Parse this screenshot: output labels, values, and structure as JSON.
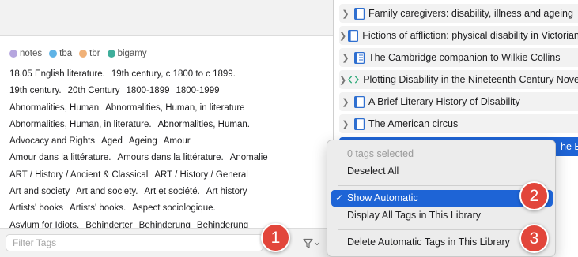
{
  "colored_tags": [
    {
      "label": "notes",
      "color": "#b6a6df"
    },
    {
      "label": "tba",
      "color": "#5fb3e6"
    },
    {
      "label": "tbr",
      "color": "#f0b177"
    },
    {
      "label": "bigamy",
      "color": "#3fae9b"
    }
  ],
  "tag_rows": [
    [
      "18.05 English literature.",
      "19th century, c 1800 to c 1899."
    ],
    [
      "19th century.",
      "20th Century",
      "1800-1899",
      "1800-1999"
    ],
    [
      "Abnormalities, Human",
      "Abnormalities, Human, in literature"
    ],
    [
      "Abnormalities, Human, in literature.",
      "Abnormalities, Human."
    ],
    [
      "Advocacy and Rights",
      "Aged",
      "Ageing",
      "Amour"
    ],
    [
      "Amour dans la littérature.",
      "Amours dans la littérature.",
      "Anomalie"
    ],
    [
      "ART / History / Ancient & Classical",
      "ART / History / General"
    ],
    [
      "Art and society",
      "Art and society.",
      "Art et société.",
      "Art history"
    ],
    [
      "Artists' books",
      "Artists' books.",
      "Aspect sociologique."
    ],
    [
      "Asylum for Idiots.",
      "Behinderter",
      "Behinderung",
      "Behinderung"
    ]
  ],
  "filter": {
    "placeholder": "Filter Tags",
    "button_icon": "filter-icon"
  },
  "items": [
    {
      "title": "Family caregivers: disability, illness and ageing",
      "icon": "book-icon"
    },
    {
      "title": "Fictions of affliction: physical disability in Victorian culture",
      "icon": "book-icon"
    },
    {
      "title": "The Cambridge companion to Wilkie Collins",
      "icon": "book-section-icon"
    },
    {
      "title": "Plotting Disability in the Nineteenth-Century Novel",
      "icon": "webpage-icon"
    },
    {
      "title": "A Brief Literary History of Disability",
      "icon": "book-icon"
    },
    {
      "title": "The American circus",
      "icon": "book-icon"
    }
  ],
  "selected_item": {
    "title": "he Ea"
  },
  "menu": {
    "status": "0 tags selected",
    "deselect_all": "Deselect All",
    "show_automatic": "Show Automatic",
    "show_automatic_checked": true,
    "display_all": "Display All Tags in This Library",
    "delete_automatic": "Delete Automatic Tags in This Library"
  },
  "callouts": [
    "1",
    "2",
    "3"
  ],
  "colors": {
    "accent": "#1e64d6",
    "callout": "#e2463b"
  }
}
